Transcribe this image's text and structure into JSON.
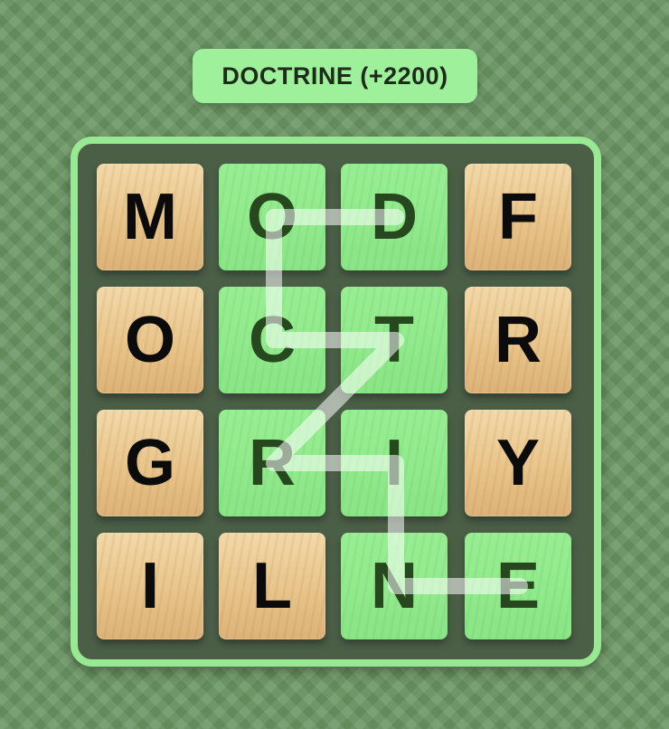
{
  "banner": {
    "text": "DOCTRINE (+2200)"
  },
  "grid": {
    "rows": [
      [
        "M",
        "O",
        "D",
        "F"
      ],
      [
        "O",
        "C",
        "T",
        "R"
      ],
      [
        "G",
        "R",
        "I",
        "Y"
      ],
      [
        "I",
        "L",
        "N",
        "E"
      ]
    ],
    "selected": [
      [
        0,
        1
      ],
      [
        0,
        2
      ],
      [
        1,
        1
      ],
      [
        1,
        2
      ],
      [
        2,
        1
      ],
      [
        2,
        2
      ],
      [
        3,
        2
      ],
      [
        3,
        3
      ]
    ]
  },
  "colors": {
    "selected_tile": "#8ee889",
    "wood_tile": "#e8c48a",
    "board_frame": "#98e894",
    "path_line": "#ffffff"
  }
}
